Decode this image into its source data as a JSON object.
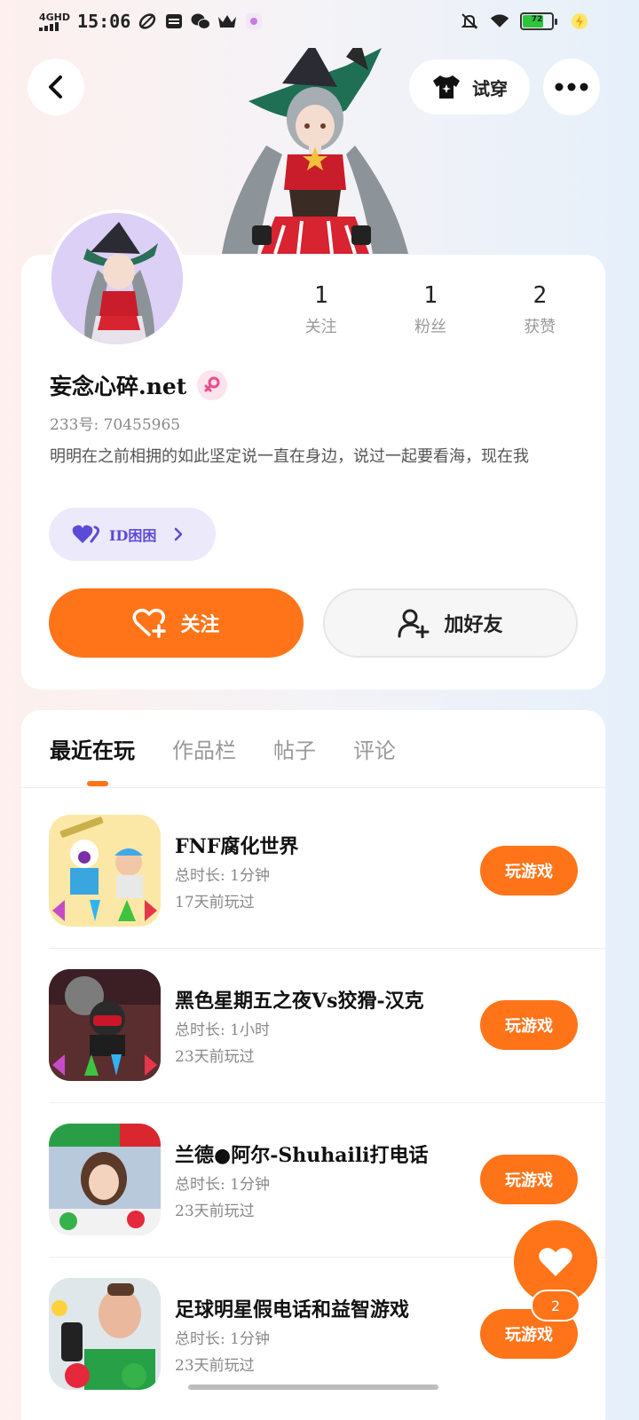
{
  "status_bar": {
    "network": "4GHD",
    "time": "15:06",
    "battery": "72"
  },
  "header": {
    "try_on_label": "试穿"
  },
  "profile": {
    "stats": [
      {
        "value": "1",
        "label": "关注"
      },
      {
        "value": "1",
        "label": "粉丝"
      },
      {
        "value": "2",
        "label": "获赞"
      }
    ],
    "name": "妄念心碎.net",
    "uid": "233号: 70455965",
    "bio": "明明在之前相拥的如此坚定说一直在身边，说过一起要看海，现在我",
    "id_badge": "ID困困",
    "follow_label": "关注",
    "add_friend_label": "加好友"
  },
  "tabs": [
    "最近在玩",
    "作品栏",
    "帖子",
    "评论"
  ],
  "games": [
    {
      "title": "FNF腐化世界",
      "duration": "总时长: 1分钟",
      "last_played": "17天前玩过",
      "button": "玩游戏"
    },
    {
      "title": "黑色星期五之夜Vs狡猾-汉克",
      "duration": "总时长: 1小时",
      "last_played": "23天前玩过",
      "button": "玩游戏"
    },
    {
      "title": "兰德●阿尔-Shuhaili打电话",
      "duration": "总时长: 1分钟",
      "last_played": "23天前玩过",
      "button": "玩游戏"
    },
    {
      "title": "足球明星假电话和益智游戏",
      "duration": "总时长: 1分钟",
      "last_played": "23天前玩过",
      "button": "玩游戏"
    }
  ],
  "fab": {
    "count": "2"
  },
  "colors": {
    "accent": "#ff7418",
    "badge_purple": "#5b4bd6",
    "background": "#f4f3f7"
  }
}
